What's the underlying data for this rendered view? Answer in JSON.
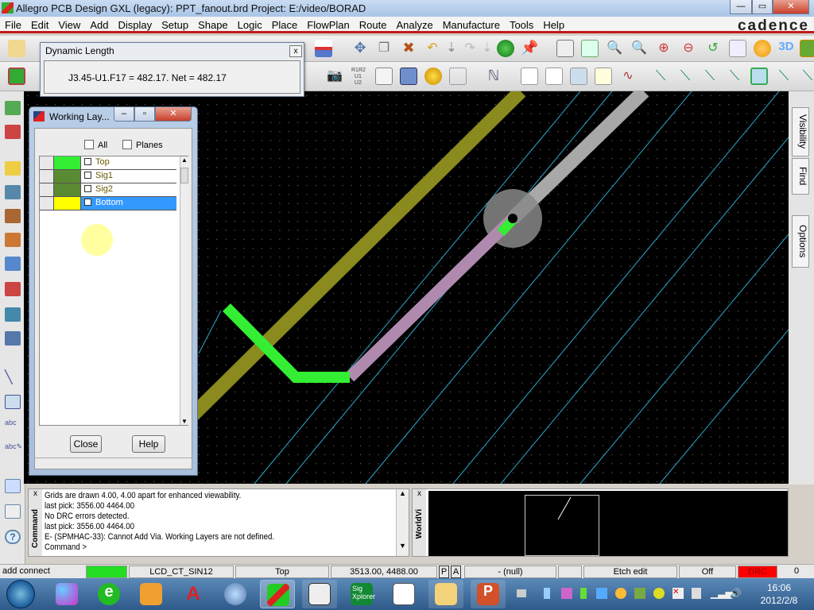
{
  "window": {
    "title": "Allegro PCB Design GXL (legacy): PPT_fanout.brd  Project: E:/video/BORAD",
    "controls": [
      "minimize",
      "maximize",
      "close"
    ]
  },
  "menu": [
    "File",
    "Edit",
    "View",
    "Add",
    "Display",
    "Setup",
    "Shape",
    "Logic",
    "Place",
    "FlowPlan",
    "Route",
    "Analyze",
    "Manufacture",
    "Tools",
    "Help"
  ],
  "brand": "cadence",
  "dynamic_length": {
    "title": "Dynamic Length",
    "value": "J3.45-U1.F17 = 482.17.  Net = 482.17"
  },
  "working_layers": {
    "title": "Working Lay...",
    "all_label": "All",
    "planes_label": "Planes",
    "layers": [
      {
        "name": "Top",
        "color": "#33ee33",
        "selected": false
      },
      {
        "name": "Sig1",
        "color": "#5a8a32",
        "selected": false
      },
      {
        "name": "Sig2",
        "color": "#5a8a32",
        "selected": false
      },
      {
        "name": "Bottom",
        "color": "#ffff00",
        "selected": true
      }
    ],
    "close_label": "Close",
    "help_label": "Help"
  },
  "side_tabs": [
    "Visibility",
    "Find",
    "Options"
  ],
  "command": {
    "panel_label": "Command",
    "lines": [
      "Grids are drawn 4.00, 4.00 apart for enhanced viewability.",
      "last pick:  3556.00  4464.00",
      "No DRC errors detected.",
      "last pick:  3556.00  4464.00",
      "E- (SPMHAC-33): Cannot Add Via.  Working Layers are not defined.",
      "Command >"
    ]
  },
  "worldview": {
    "panel_label": "WorldVi"
  },
  "status": {
    "command": "add connect",
    "layer_color": "#22dd22",
    "net": "LCD_CT_SIN12",
    "layer": "Top",
    "coords": "3513.00, 4488.00",
    "p": "P",
    "a": "A",
    "null": "- (null)",
    "mode": "Etch edit",
    "off": "Off",
    "drc": "DRC",
    "drc_color": "#ff0000",
    "count": "0"
  },
  "taskbar": {
    "time": "16:06",
    "date": "2012/2/8",
    "sig_label": "Sig Xplorer"
  }
}
